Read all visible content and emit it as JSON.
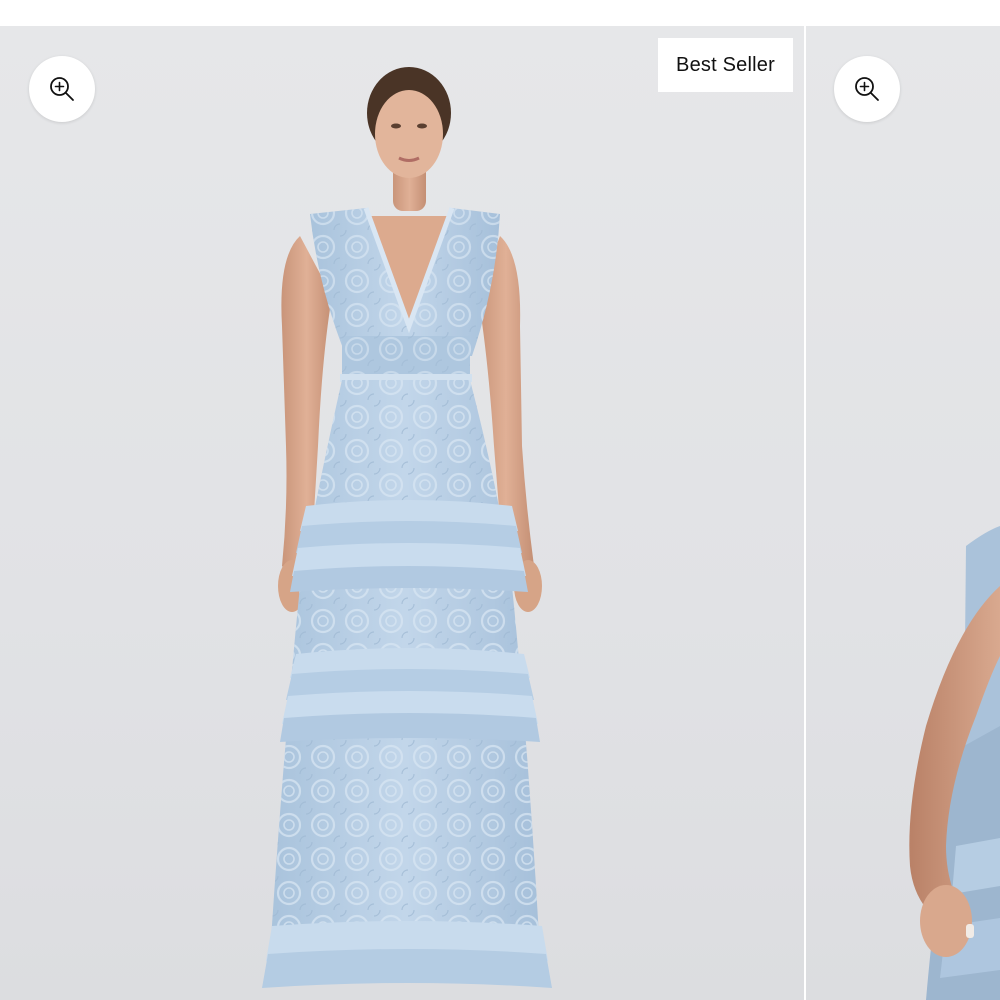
{
  "gallery": {
    "badge": {
      "label": "Best Seller"
    },
    "slides": [
      {
        "name": "product-image-front",
        "zoom_icon": "zoom-in-icon"
      },
      {
        "name": "product-image-side",
        "zoom_icon": "zoom-in-icon"
      }
    ]
  },
  "colors": {
    "background": "#e3e4e7",
    "dress": "#b9d0e6",
    "badge_bg": "#ffffff",
    "badge_text": "#111111"
  }
}
